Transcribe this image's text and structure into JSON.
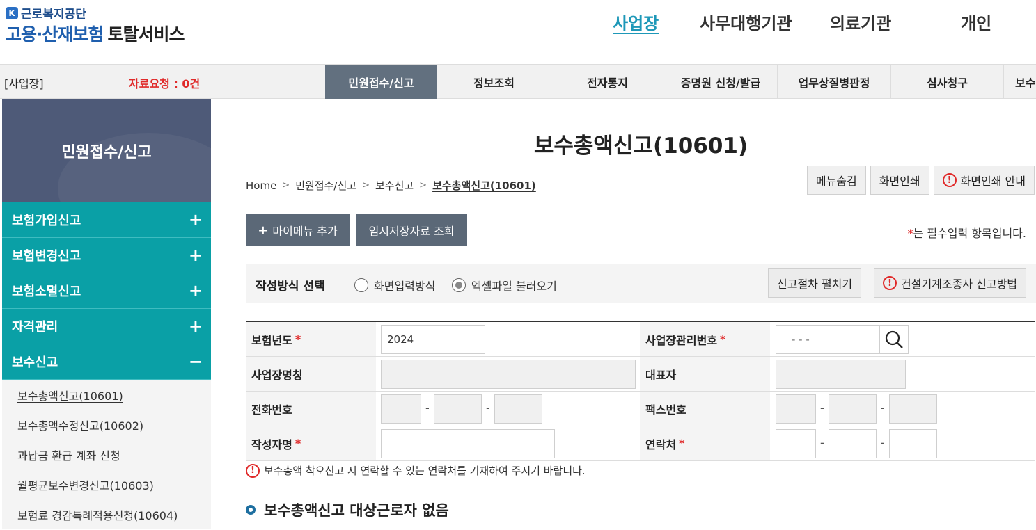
{
  "header": {
    "org_name": "근로복지공단",
    "service_title_blue": "고용·산재보험",
    "service_title_dark": "토탈서비스",
    "nav": [
      "사업장",
      "사무대행기관",
      "의료기관",
      "개인"
    ]
  },
  "menubar": {
    "context": "[사업장]",
    "data_request": "자료요청 : 0건",
    "gnb": [
      "민원접수/신고",
      "정보조회",
      "전자통지",
      "증명원 신청/발급",
      "업무상질병판정",
      "심사청구",
      "보수"
    ]
  },
  "sidebar": {
    "title": "민원접수/신고",
    "groups": [
      {
        "label": "보험가입신고",
        "sign": "+"
      },
      {
        "label": "보험변경신고",
        "sign": "+"
      },
      {
        "label": "보험소멸신고",
        "sign": "+"
      },
      {
        "label": "자격관리",
        "sign": "+"
      },
      {
        "label": "보수신고",
        "sign": "−"
      }
    ],
    "sub_items": [
      "보수총액신고(10601)",
      "보수총액수정신고(10602)",
      "과납금 환급 계좌 신청",
      "월평균보수변경신고(10603)",
      "보험료 경감특례적용신청(10604)"
    ]
  },
  "page": {
    "title": "보수총액신고(10601)",
    "breadcrumb": [
      "Home",
      "민원접수/신고",
      "보수신고",
      "보수총액신고(10601)"
    ],
    "buttons": {
      "hide_menu": "메뉴숨김",
      "print": "화면인쇄",
      "print_guide": "화면인쇄 안내"
    },
    "add_mymenu": "마이메뉴 추가",
    "temp_saved": "임시저장자료 조회",
    "required_note": "는 필수입력 항목입니다.",
    "method": {
      "label": "작성방식 선택",
      "options": [
        "화면입력방식",
        "엑셀파일 불러오기"
      ],
      "selected": "엑셀파일 불러오기",
      "expand_btn": "신고절차 펼치기",
      "guide_btn": "건설기계조종사 신고방법"
    },
    "form": {
      "insurance_year_label": "보험년도",
      "insurance_year": "2024",
      "biz_no_label": "사업장관리번호",
      "biz_no_placeholder": "-   -   -",
      "biz_name_label": "사업장명칭",
      "ceo_label": "대표자",
      "phone_label": "전화번호",
      "fax_label": "팩스번호",
      "writer_label": "작성자명",
      "contact_label": "연락처",
      "dash": "-"
    },
    "notice": "보수총액 착오신고 시 연락할 수 있는 연락처를 기재하여 주시기 바랍니다.",
    "section_title": "보수총액신고 대상근로자 없음"
  },
  "colors": {
    "teal": "#0aa0a6",
    "navy": "#4e5a78",
    "gnb_active": "#62707f",
    "red": "#e02a2a",
    "link": "#1e98b8"
  }
}
